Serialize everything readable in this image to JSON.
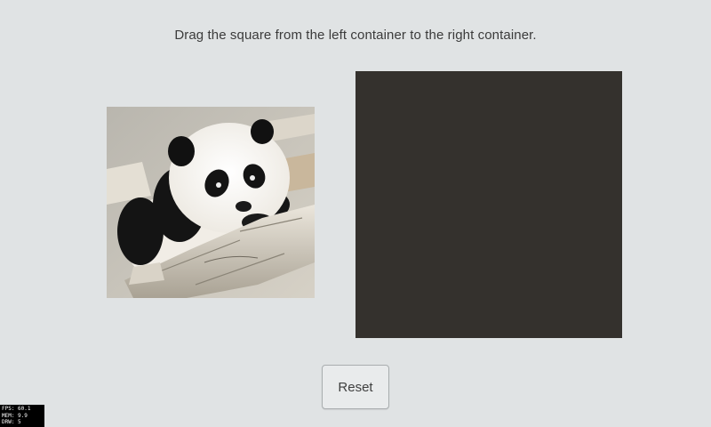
{
  "instruction": "Drag the square from the left container to the right container.",
  "left_container": {
    "image_subject": "panda-cub-on-branch"
  },
  "right_container": {
    "color": "#34312d"
  },
  "reset_label": "Reset",
  "debug": {
    "fps": "FPS: 60.1",
    "mem": "MEM: 9.9",
    "drw": "DRW: 5"
  },
  "colors": {
    "background": "#e0e3e4",
    "drop_target": "#34312d",
    "button_border": "#a9adaf"
  }
}
